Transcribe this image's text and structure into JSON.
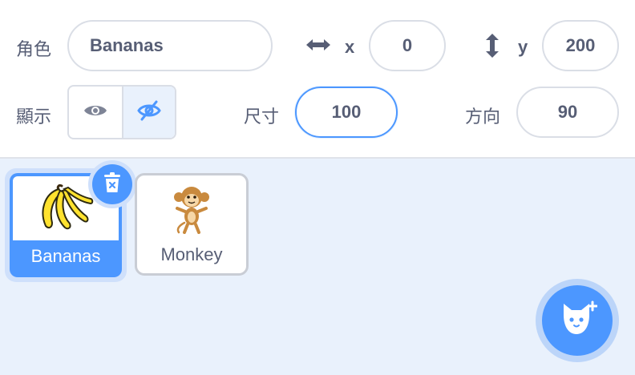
{
  "sprite_info": {
    "sprite_label": "角色",
    "sprite_name": "Bananas",
    "x_label": "x",
    "x_value": "0",
    "y_label": "y",
    "y_value": "200",
    "show_label": "顯示",
    "show_visible_selected": true,
    "size_label": "尺寸",
    "size_value": "100",
    "direction_label": "方向",
    "direction_value": "90"
  },
  "sprites": [
    {
      "name": "Bananas",
      "icon": "bananas-icon",
      "selected": true
    },
    {
      "name": "Monkey",
      "icon": "monkey-icon",
      "selected": false
    }
  ],
  "icons": {
    "x_axis": "horizontal-arrows-icon",
    "y_axis": "vertical-arrows-icon",
    "show": "eye-icon",
    "hide": "eye-slash-icon",
    "delete": "trash-icon",
    "add_sprite": "cat-plus-icon"
  },
  "colors": {
    "accent": "#4c97ff",
    "text": "#575e75",
    "sprite_area_bg": "#e9f1fc",
    "border": "#dadee6"
  }
}
